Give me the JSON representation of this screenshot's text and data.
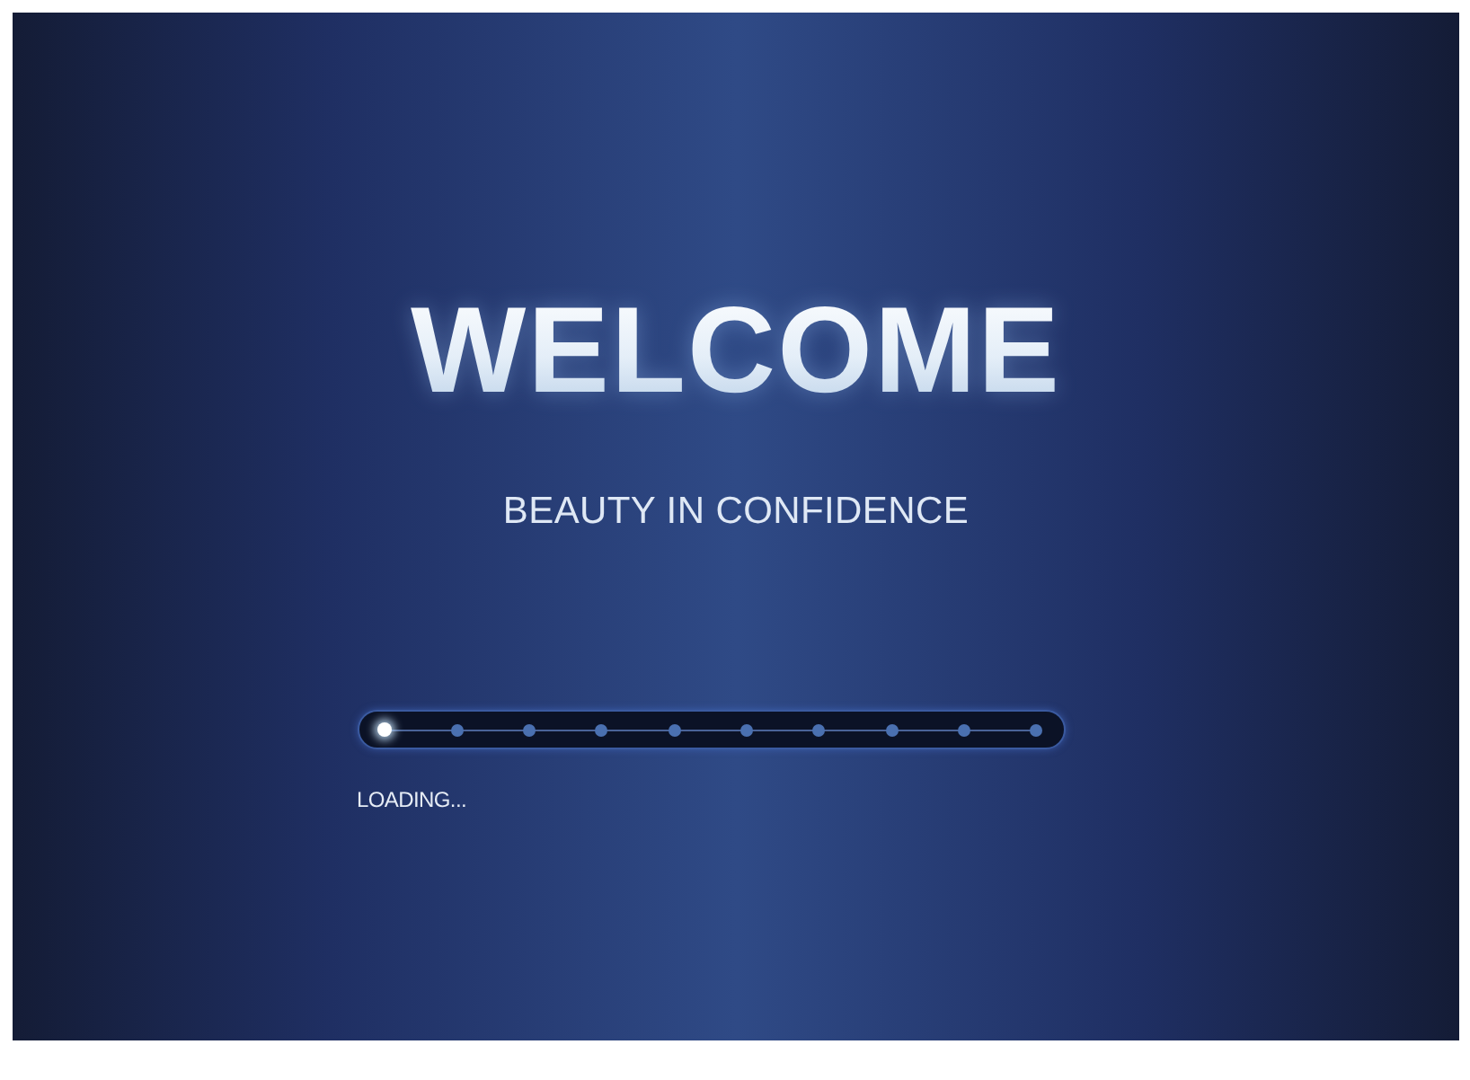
{
  "title": "WELCOME",
  "subtitle": "BEAUTY IN CONFIDENCE",
  "progress": {
    "dots": [
      {
        "on": true
      },
      {
        "on": false
      },
      {
        "on": false
      },
      {
        "on": false
      },
      {
        "on": false
      },
      {
        "on": false
      },
      {
        "on": false
      },
      {
        "on": false
      },
      {
        "on": false
      },
      {
        "on": false
      }
    ]
  },
  "status": "LOADING..."
}
